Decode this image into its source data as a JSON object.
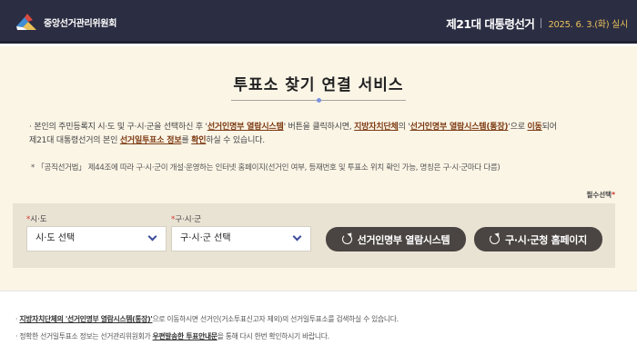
{
  "header": {
    "logo_text": "중앙선거관리위원회",
    "election_title": "제21대 대통령선거",
    "election_date": "2025. 6. 3.(화) 실시"
  },
  "main": {
    "title": "투표소 찾기 연결 서비스",
    "desc": {
      "bullet": "·",
      "p1": "본인의 주민등록지 시·도 및 구·시·군을 선택하신 후 '",
      "link1": "선거인명부 열람시스템",
      "p2": "' 버튼을 클릭하시면, ",
      "link2": "지방자치단체",
      "p3": "의 '",
      "link3": "선거인명부 열람시스템(통장)",
      "p4": "'으로 ",
      "link4": "이동",
      "p5": "되어",
      "p6": "제21대 대통령선거의 본인 ",
      "link5": "선거일투표소 정보",
      "p7": "를 ",
      "link6": "확인",
      "p8": "하실 수 있습니다."
    },
    "note": "* 「공직선거법」 제44조에 따라 구·시·군이 개설·운영하는 인터넷 홈페이지(선거인 여부, 등재번호 및 투표소 위치 확인 가능, 명칭은 구·시·군마다 다름)",
    "required_label": "필수선택",
    "required_star": "*",
    "form": {
      "sido_label": "시·도",
      "sido_value": "시·도 선택",
      "gusigun_label": "구·시·군",
      "gusigun_value": "구·시·군 선택",
      "btn_register": "선거인명부 열람시스템",
      "btn_homepage": "구·시·군청 홈페이지"
    }
  },
  "footer": {
    "line1_link": "지방자치단체의 '선거인명부 열람시스템(통장)'",
    "line1_text": "으로 이동하시면 선거인(거소투표신고자 제외)의 선거일투표소를 검색하실 수 있습니다.",
    "line2_a": "정확한 선거일투표소 정보는 선거관리위원회가 ",
    "line2_link": "우편발송한 투표안내문",
    "line2_b": "을 통해 다시 한번 확인하시기 바랍니다."
  },
  "colors": {
    "header_bg": "#2b2d42",
    "accent_gold": "#e8c15a",
    "main_bg": "#fbf5e6",
    "button_bg": "#4a4542",
    "link_brown": "#7c3a12",
    "required_red": "#d0342c"
  }
}
